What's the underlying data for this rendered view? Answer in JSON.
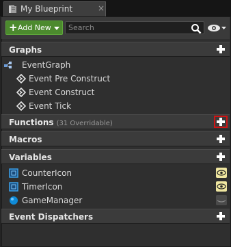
{
  "tab": {
    "title": "My Blueprint",
    "close": "×"
  },
  "toolbar": {
    "add_new_label": "Add New",
    "search_placeholder": "Search"
  },
  "graphs": {
    "title": "Graphs",
    "event_graph": "EventGraph",
    "events": [
      "Event Pre Construct",
      "Event Construct",
      "Event Tick"
    ]
  },
  "functions": {
    "title": "Functions",
    "subtitle": "(31 Overridable)"
  },
  "macros": {
    "title": "Macros"
  },
  "variables": {
    "title": "Variables",
    "items": [
      {
        "name": "CounterIcon",
        "type": "object-reference",
        "visible": true
      },
      {
        "name": "TimerIcon",
        "type": "object-reference",
        "visible": true
      },
      {
        "name": "GameManager",
        "type": "object",
        "visible": false
      }
    ]
  },
  "event_dispatchers": {
    "title": "Event Dispatchers"
  },
  "colors": {
    "accent_green": "#4c8a2e",
    "highlight_red": "#d01414",
    "panel_bg": "#2f2f2f",
    "header_bg": "#3b3b3b"
  }
}
